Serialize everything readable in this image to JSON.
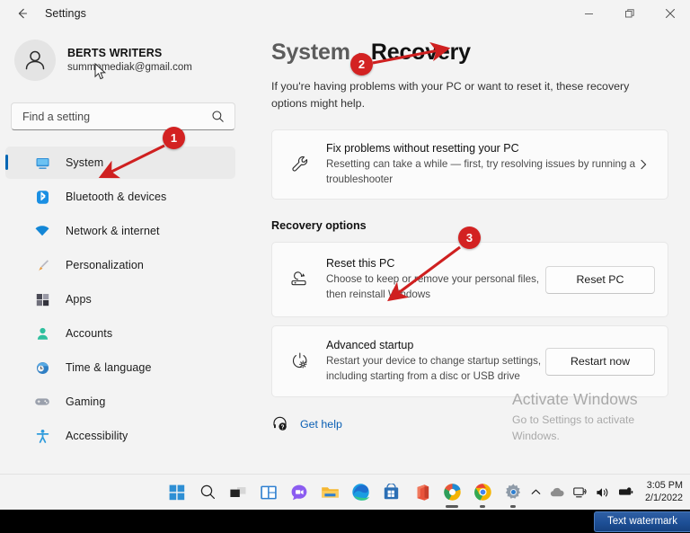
{
  "window": {
    "title": "Settings",
    "back_icon": "back-arrow-icon",
    "minimize_label": "Minimize",
    "restore_label": "Restore",
    "close_label": "Close"
  },
  "account": {
    "name": "BERTS WRITERS",
    "email": "summnmediak@gmail.com",
    "avatar_icon": "person-avatar-icon"
  },
  "search": {
    "placeholder": "Find a setting",
    "value": "",
    "icon": "search-icon"
  },
  "sidebar": {
    "items": [
      {
        "label": "System",
        "icon": "monitor-icon",
        "active": true
      },
      {
        "label": "Bluetooth & devices",
        "icon": "bluetooth-icon",
        "active": false
      },
      {
        "label": "Network & internet",
        "icon": "wifi-icon",
        "active": false
      },
      {
        "label": "Personalization",
        "icon": "paintbrush-icon",
        "active": false
      },
      {
        "label": "Apps",
        "icon": "apps-grid-icon",
        "active": false
      },
      {
        "label": "Accounts",
        "icon": "account-person-icon",
        "active": false
      },
      {
        "label": "Time & language",
        "icon": "clock-globe-icon",
        "active": false
      },
      {
        "label": "Gaming",
        "icon": "gamepad-icon",
        "active": false
      },
      {
        "label": "Accessibility",
        "icon": "accessibility-person-icon",
        "active": false
      }
    ]
  },
  "main": {
    "breadcrumb_parent": "System",
    "breadcrumb_separator": "›",
    "breadcrumb_current": "Recovery",
    "intro": "If you're having problems with your PC or want to reset it, these recovery options might help.",
    "fix_card": {
      "title": "Fix problems without resetting your PC",
      "subtitle": "Resetting can take a while — first, try resolving issues by running a troubleshooter",
      "icon": "wrench-icon",
      "chevron": "chevron-right-icon"
    },
    "section_title": "Recovery options",
    "options": [
      {
        "title": "Reset this PC",
        "subtitle": "Choose to keep or remove your personal files, then reinstall Windows",
        "icon": "reset-pc-icon",
        "button": "Reset PC"
      },
      {
        "title": "Advanced startup",
        "subtitle": "Restart your device to change startup settings, including starting from a disc or USB drive",
        "icon": "power-gear-icon",
        "button": "Restart now"
      }
    ],
    "get_help": {
      "label": "Get help",
      "icon": "help-headset-icon"
    }
  },
  "activate_watermark": {
    "title": "Activate Windows",
    "subtitle": "Go to Settings to activate Windows."
  },
  "annotations": [
    {
      "number": "1",
      "target": "sidebar-item-system"
    },
    {
      "number": "2",
      "target": "breadcrumb-current"
    },
    {
      "number": "3",
      "target": "reset-this-pc-card"
    }
  ],
  "taskbar": {
    "icons": [
      {
        "name": "start-icon",
        "label": "Start"
      },
      {
        "name": "search-icon",
        "label": "Search"
      },
      {
        "name": "task-view-icon",
        "label": "Task view"
      },
      {
        "name": "widgets-icon",
        "label": "Widgets"
      },
      {
        "name": "chat-teams-icon",
        "label": "Chat"
      },
      {
        "name": "file-explorer-icon",
        "label": "File Explorer"
      },
      {
        "name": "edge-icon",
        "label": "Microsoft Edge"
      },
      {
        "name": "microsoft-store-icon",
        "label": "Microsoft Store"
      },
      {
        "name": "office-icon",
        "label": "Office"
      },
      {
        "name": "edge-canary-icon",
        "label": "Microsoft Edge Canary"
      },
      {
        "name": "chrome-icon",
        "label": "Google Chrome"
      },
      {
        "name": "settings-gear-icon",
        "label": "Settings"
      }
    ],
    "tray": [
      {
        "name": "show-hidden-icons-chevron",
        "label": "Show hidden icons"
      },
      {
        "name": "onedrive-cloud-icon",
        "label": "OneDrive"
      },
      {
        "name": "network-icon",
        "label": "Network"
      },
      {
        "name": "volume-icon",
        "label": "Volume"
      },
      {
        "name": "battery-icon",
        "label": "Battery"
      }
    ],
    "time": "3:05 PM",
    "date": "2/1/2022"
  },
  "overlay": {
    "text_watermark": "Text watermark"
  }
}
